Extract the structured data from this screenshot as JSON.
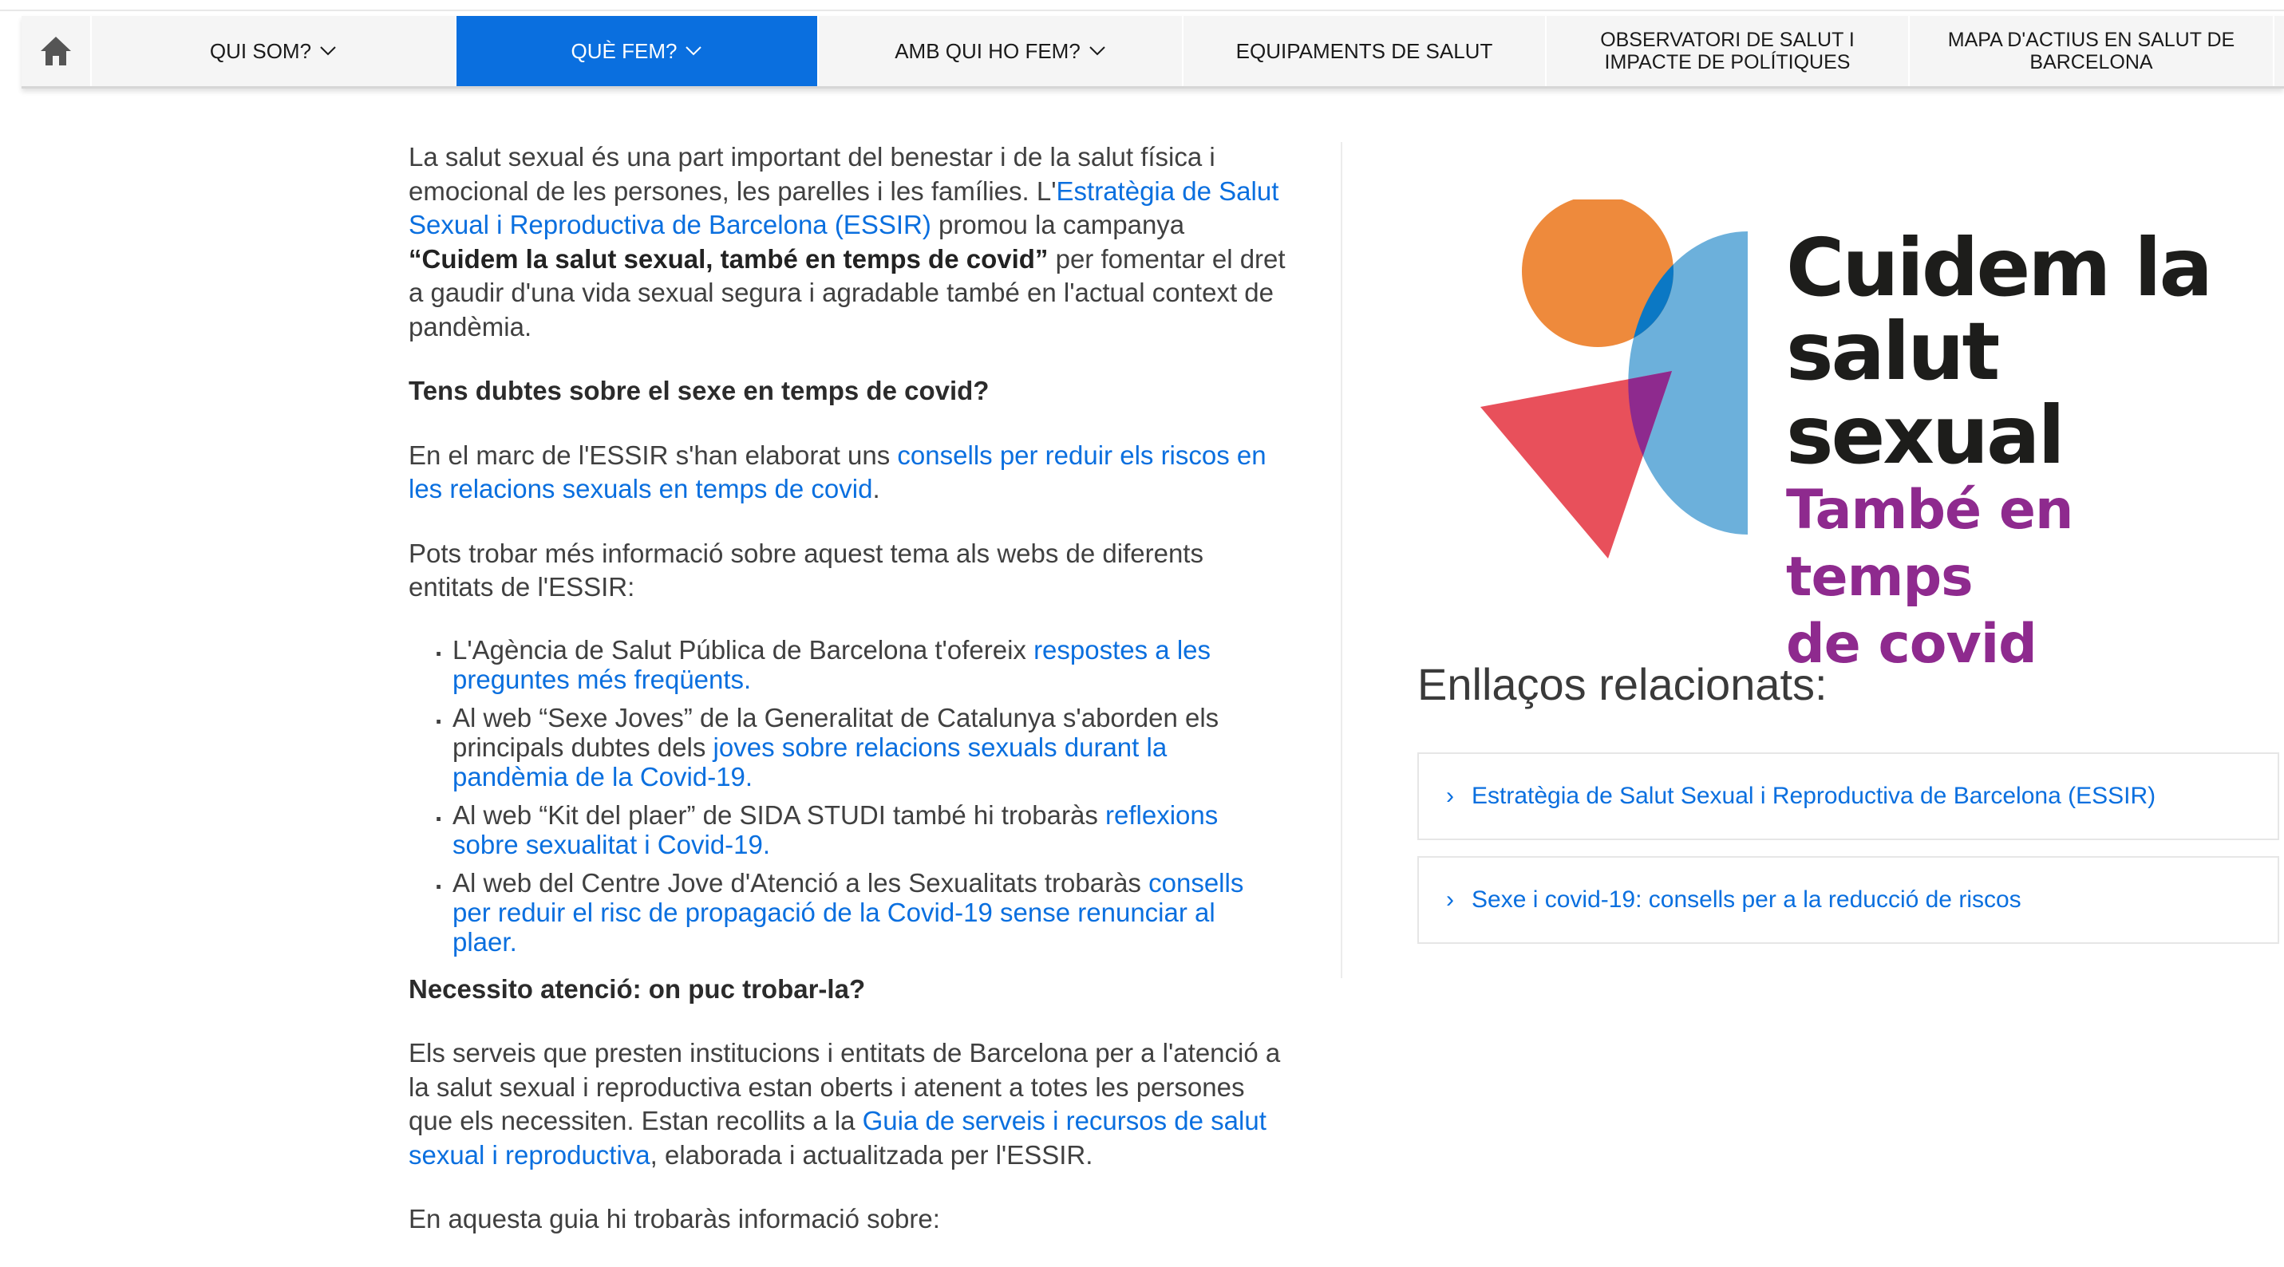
{
  "nav": {
    "home_icon": "home-icon",
    "items": [
      {
        "label": "QUI SOM?",
        "dropdown": true
      },
      {
        "label": "QUÈ FEM?",
        "dropdown": true,
        "active": true
      },
      {
        "label": "AMB QUI HO FEM?",
        "dropdown": true
      },
      {
        "label": "EQUIPAMENTS DE SALUT",
        "dropdown": false
      },
      {
        "label": "OBSERVATORI DE SALUT I IMPACTE DE POLÍTIQUES",
        "dropdown": false
      },
      {
        "label": "MAPA D'ACTIUS EN SALUT DE BARCELONA",
        "dropdown": false
      }
    ],
    "active_color": "#0a6fdf"
  },
  "article": {
    "intro": {
      "t1": "La salut sexual és una part important del benestar i de la salut física i emocional de les persones, les parelles i les famílies. L'",
      "link": "Estratègia de Salut Sexual i Reproductiva de Barcelona (ESSIR)",
      "t2": " promou la campanya ",
      "bold": "“Cuidem la salut sexual, també en temps de covid”",
      "t3": " per fomentar el dret a gaudir d'una vida sexual segura i agradable també en l'actual context de pandèmia."
    },
    "heading1": "Tens dubtes sobre el sexe en temps de covid?",
    "p2": {
      "t1": "En el marc de l'ESSIR s'han elaborat uns ",
      "link": "consells per reduir els riscos en les relacions sexuals en temps de covid",
      "t2": "."
    },
    "p3": "Pots trobar més informació sobre aquest tema als webs de diferents entitats de l'ESSIR:",
    "list": [
      {
        "text": "L'Agència de Salut Pública de Barcelona t'ofereix ",
        "link": "respostes a les preguntes més freqüents",
        "after": "."
      },
      {
        "text": "Al web “Sexe Joves” de la Generalitat de Catalunya s'aborden els principals dubtes dels ",
        "link": "joves sobre relacions sexuals durant la pandèmia de la Covid-19",
        "after": "."
      },
      {
        "text": "Al web “Kit del plaer” de SIDA STUDI també hi trobaràs ",
        "link": "reflexions sobre sexualitat i Covid-19",
        "after": "."
      },
      {
        "text": "Al web del Centre Jove d'Atenció a les Sexualitats trobaràs ",
        "link": "consells per reduir el risc de propagació de la Covid-19 sense renunciar al plaer",
        "after": "."
      }
    ],
    "heading2": "Necessito atenció: on puc trobar-la?",
    "p4": {
      "t1": "Els serveis que presten institucions i entitats de Barcelona per a l'atenció a la salut sexual i reproductiva estan oberts i atenent a totes les persones que els necessiten. Estan recollits a la ",
      "link": "Guia de serveis i recursos de salut sexual i reproductiva",
      "t2": ", elaborada i actualitzada per l'ESSIR."
    },
    "p5": "En aquesta guia hi trobaràs informació sobre:"
  },
  "logo": {
    "line1": "Cuidem la",
    "line2": "salut sexual",
    "line3": "També en temps",
    "line4": "de covid",
    "colors": {
      "orange": "#ee8a3c",
      "blue": "#6cb0db",
      "dark_blue": "#0b78c4",
      "red": "#e8505b",
      "purple": "#8e2a8e"
    }
  },
  "related": {
    "title": "Enllaços relacionats:",
    "links": [
      {
        "label": "Estratègia de Salut Sexual i Reproductiva de Barcelona (ESSIR)"
      },
      {
        "label": "Sexe i covid-19: consells per a la reducció de riscos"
      }
    ]
  }
}
